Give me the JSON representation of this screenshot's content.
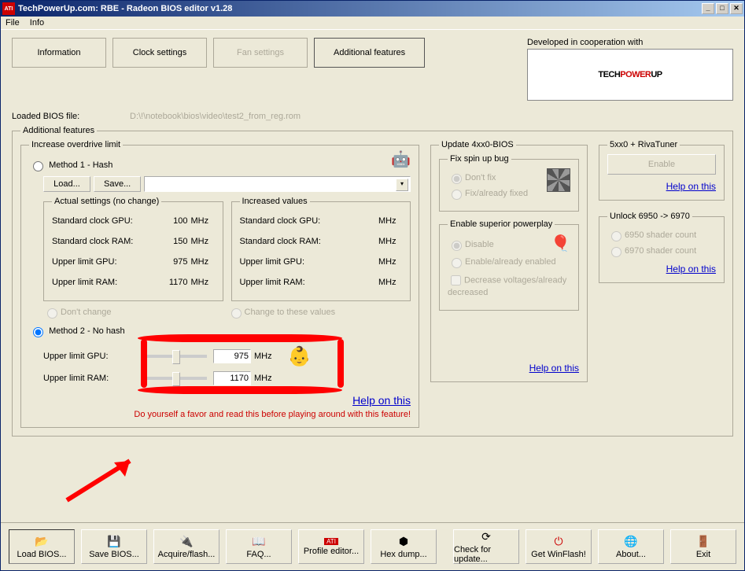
{
  "title": "TechPowerUp.com: RBE - Radeon BIOS editor v1.28",
  "menu": {
    "file": "File",
    "info": "Info"
  },
  "coop": {
    "label": "Developed in cooperation with",
    "logo_a": "TECH",
    "logo_b": "POWER",
    "logo_c": "UP"
  },
  "tabs": {
    "info": "Information",
    "clock": "Clock settings",
    "fan": "Fan settings",
    "add": "Additional features"
  },
  "loaded": {
    "label": "Loaded BIOS file:",
    "path": "D:\\!\\notebook\\bios\\video\\test2_from_reg.rom"
  },
  "af_legend": "Additional features",
  "od": {
    "legend": "Increase overdrive limit",
    "m1": "Method 1 - Hash",
    "load": "Load...",
    "save": "Save...",
    "actual_legend": "Actual settings (no change)",
    "increased_legend": "Increased values",
    "rows": {
      "std_gpu": "Standard clock GPU:",
      "std_ram": "Standard clock RAM:",
      "up_gpu": "Upper limit GPU:",
      "up_ram": "Upper limit RAM:"
    },
    "vals": {
      "std_gpu": "100",
      "std_ram": "150",
      "up_gpu": "975",
      "up_ram": "1170"
    },
    "unit": "MHz",
    "dont_change": "Don't change",
    "change_to": "Change to these values",
    "m2": "Method 2 - No hash",
    "m2_gpu": "Upper limit GPU:",
    "m2_gpu_val": "975",
    "m2_ram": "Upper limit RAM:",
    "m2_ram_val": "1170",
    "help": "Help on this",
    "warn": "Do yourself a favor and read this before playing around with this feature!"
  },
  "update": {
    "legend": "Update 4xx0-BIOS",
    "fix_legend": "Fix spin up bug",
    "dont_fix": "Don't fix",
    "fix_already": "Fix/already fixed",
    "pp_legend": "Enable superior powerplay",
    "disable": "Disable",
    "enable_already": "Enable/already enabled",
    "decrease": "Decrease voltages/already decreased",
    "help": "Help on this"
  },
  "riva": {
    "legend": "5xx0 + RivaTuner",
    "enable": "Enable",
    "help": "Help on this"
  },
  "unlock": {
    "legend": "Unlock 6950 -> 6970",
    "opt1": "6950 shader count",
    "opt2": "6970 shader count",
    "help": "Help on this"
  },
  "buttons": {
    "load": "Load BIOS...",
    "save": "Save BIOS...",
    "acquire": "Acquire/flash...",
    "faq": "FAQ...",
    "profile": "Profile editor...",
    "hex": "Hex dump...",
    "check": "Check for update...",
    "winflash": "Get WinFlash!",
    "about": "About...",
    "exit": "Exit"
  }
}
